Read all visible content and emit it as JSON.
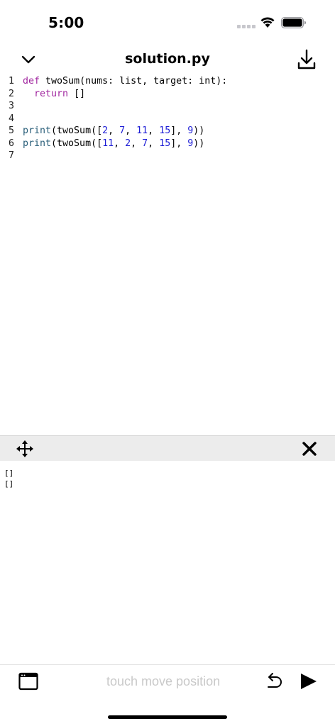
{
  "status_bar": {
    "time": "5:00"
  },
  "header": {
    "title": "solution.py"
  },
  "editor": {
    "lines": [
      {
        "number": "1",
        "tokens": [
          {
            "text": "def",
            "kind": "kw"
          },
          {
            "text": " twoSum(nums: list, target: int):",
            "kind": "plain"
          }
        ]
      },
      {
        "number": "2",
        "tokens": [
          {
            "text": "  ",
            "kind": "plain"
          },
          {
            "text": "return",
            "kind": "kw"
          },
          {
            "text": " []",
            "kind": "plain"
          }
        ]
      },
      {
        "number": "3",
        "tokens": []
      },
      {
        "number": "4",
        "tokens": []
      },
      {
        "number": "5",
        "tokens": [
          {
            "text": "print",
            "kind": "fn"
          },
          {
            "text": "(twoSum([",
            "kind": "plain"
          },
          {
            "text": "2",
            "kind": "num"
          },
          {
            "text": ", ",
            "kind": "plain"
          },
          {
            "text": "7",
            "kind": "num"
          },
          {
            "text": ", ",
            "kind": "plain"
          },
          {
            "text": "11",
            "kind": "num"
          },
          {
            "text": ", ",
            "kind": "plain"
          },
          {
            "text": "15",
            "kind": "num"
          },
          {
            "text": "], ",
            "kind": "plain"
          },
          {
            "text": "9",
            "kind": "num"
          },
          {
            "text": "))",
            "kind": "plain"
          }
        ]
      },
      {
        "number": "6",
        "tokens": [
          {
            "text": "print",
            "kind": "fn"
          },
          {
            "text": "(twoSum([",
            "kind": "plain"
          },
          {
            "text": "11",
            "kind": "num"
          },
          {
            "text": ", ",
            "kind": "plain"
          },
          {
            "text": "2",
            "kind": "num"
          },
          {
            "text": ", ",
            "kind": "plain"
          },
          {
            "text": "7",
            "kind": "num"
          },
          {
            "text": ", ",
            "kind": "plain"
          },
          {
            "text": "15",
            "kind": "num"
          },
          {
            "text": "], ",
            "kind": "plain"
          },
          {
            "text": "9",
            "kind": "num"
          },
          {
            "text": "))",
            "kind": "plain"
          }
        ]
      },
      {
        "number": "7",
        "tokens": []
      }
    ]
  },
  "console": {
    "output": [
      "[]",
      "[]"
    ]
  },
  "toolbar": {
    "hint": "touch move position"
  },
  "colors": {
    "keyword": "#a0269f",
    "function": "#2a5f7a",
    "number": "#1d1dd6",
    "hint": "#c9c9c9",
    "console_bar": "#ececec"
  },
  "icons": {
    "collapse": "chevron-down-icon",
    "download": "download-icon",
    "move": "move-arrows-icon",
    "close": "close-icon",
    "window": "browser-window-icon",
    "undo": "undo-icon",
    "run": "play-icon"
  }
}
